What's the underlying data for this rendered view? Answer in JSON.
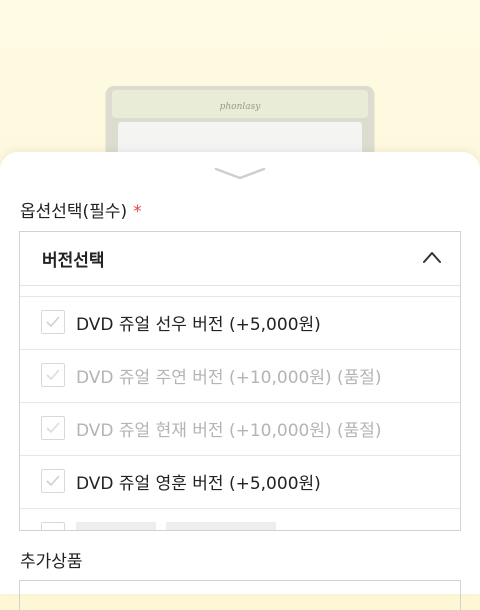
{
  "product_image": {
    "brand_text": "phonlasy"
  },
  "option_section": {
    "label": "옵션선택(필수)",
    "required_mark": "*"
  },
  "version_select": {
    "title": "버전선택",
    "items": [
      {
        "label": "DVD 쥬얼 선우 버전 (+5,000원)",
        "enabled": true
      },
      {
        "label": "DVD 쥬얼 주연 버전 (+10,000원) (품절)",
        "enabled": false
      },
      {
        "label": "DVD 쥬얼 현재 버전 (+10,000원) (품절)",
        "enabled": false
      },
      {
        "label": "DVD 쥬얼 영훈 버전 (+5,000원)",
        "enabled": true
      }
    ]
  },
  "extra_section": {
    "label": "추가상품"
  },
  "colors": {
    "accent_required": "#e0474c",
    "disabled_text": "#b4b4b4",
    "backdrop": "#fcf3cd"
  }
}
